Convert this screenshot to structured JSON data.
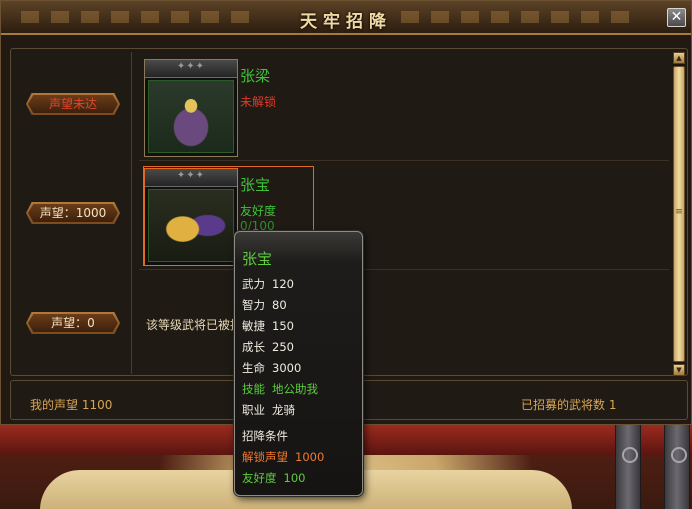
{
  "window": {
    "title": "天牢招降",
    "close_label": "✕"
  },
  "rows": [
    {
      "rank_label": "声望未达",
      "hero_name": "张梁",
      "status": "未解锁"
    },
    {
      "rank_label": "声望：1000",
      "hero_name": "张宝",
      "status_label": "友好度",
      "status_value": "0/100"
    },
    {
      "rank_label": "声望：0",
      "note": "该等级武将已被招"
    }
  ],
  "footer": {
    "my_reputation": "我的声望 1100",
    "recruited_count": "已招募的武将数 1"
  },
  "tooltip": {
    "name": "张宝",
    "stats": [
      {
        "label": "武力",
        "value": "120"
      },
      {
        "label": "智力",
        "value": "80"
      },
      {
        "label": "敏捷",
        "value": "150"
      },
      {
        "label": "成长",
        "value": "250"
      },
      {
        "label": "生命",
        "value": "3000"
      }
    ],
    "skill": {
      "label": "技能",
      "value": "地公助我"
    },
    "job": {
      "label": "职业",
      "value": "龙骑"
    },
    "requirements_header": "招降条件",
    "req_reputation": {
      "label": "解锁声望",
      "value": "1000"
    },
    "req_friendship": {
      "label": "友好度",
      "value": "100"
    }
  },
  "icons": {
    "close": "close-icon",
    "scroll_up": "arrow-up-icon",
    "scroll_down": "arrow-down-icon"
  }
}
